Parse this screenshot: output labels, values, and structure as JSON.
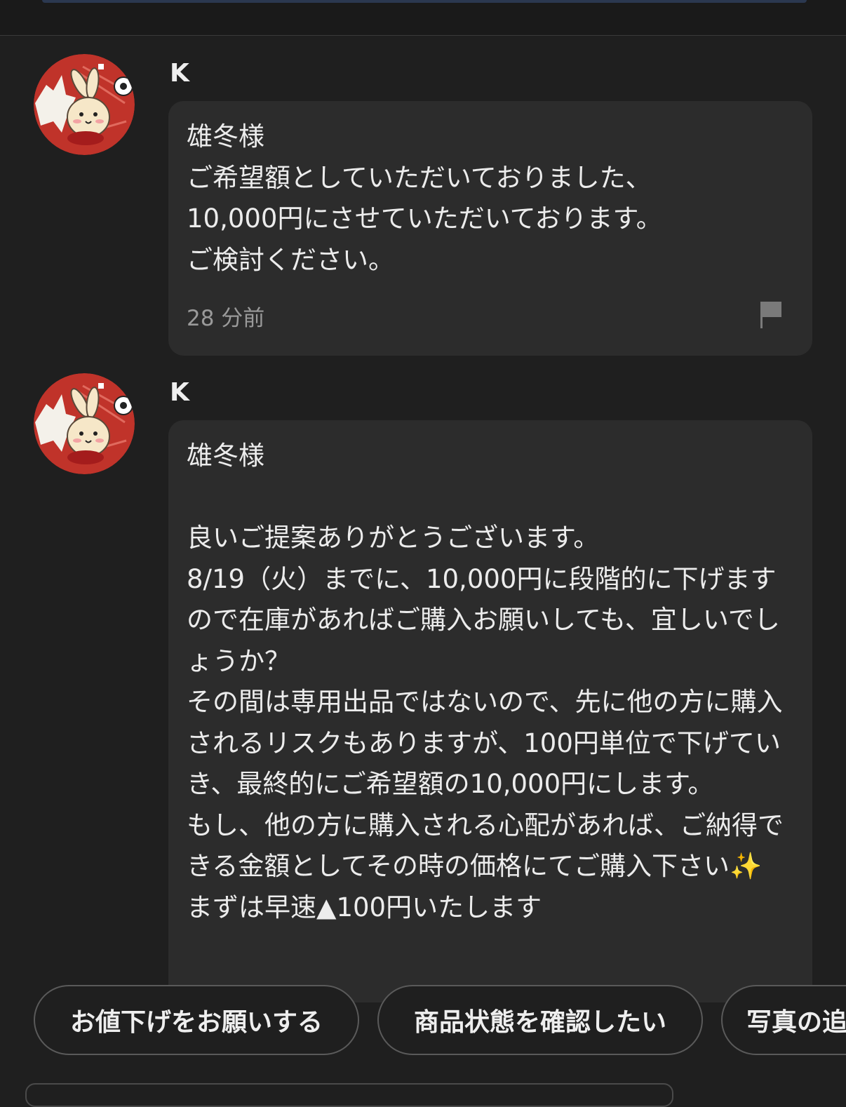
{
  "messages": [
    {
      "sender": "K",
      "text": "雄冬様\nご希望額としていただいておりました、\n10,000円にさせていただいております。\nご検討ください。",
      "time": "28 分前"
    },
    {
      "sender": "K",
      "text": "雄冬様\n\n良いご提案ありがとうございます。\n8/19（火）までに、10,000円に段階的に下げますので在庫があればご購入お願いしても、宜しいでしょうか？\nその間は専用出品ではないので、先に他の方に購入されるリスクもありますが、100円単位で下げていき、最終的にご希望額の10,000円にします。\nもし、他の方に購入される心配があれば、ご納得できる金額としてその時の価格にてご購入下さい✨\nまずは早速▲100円いたします"
    }
  ],
  "quick_replies": [
    "お値下げをお願いする",
    "商品状態を確認したい",
    "写真の追加をお願いしたい"
  ],
  "colors": {
    "background": "#1f1f1f",
    "bubble": "#2c2c2c",
    "avatar_red": "#c0332a"
  },
  "icons": {
    "avatar": "rabbit-avatar-icon",
    "report": "flag-icon"
  }
}
